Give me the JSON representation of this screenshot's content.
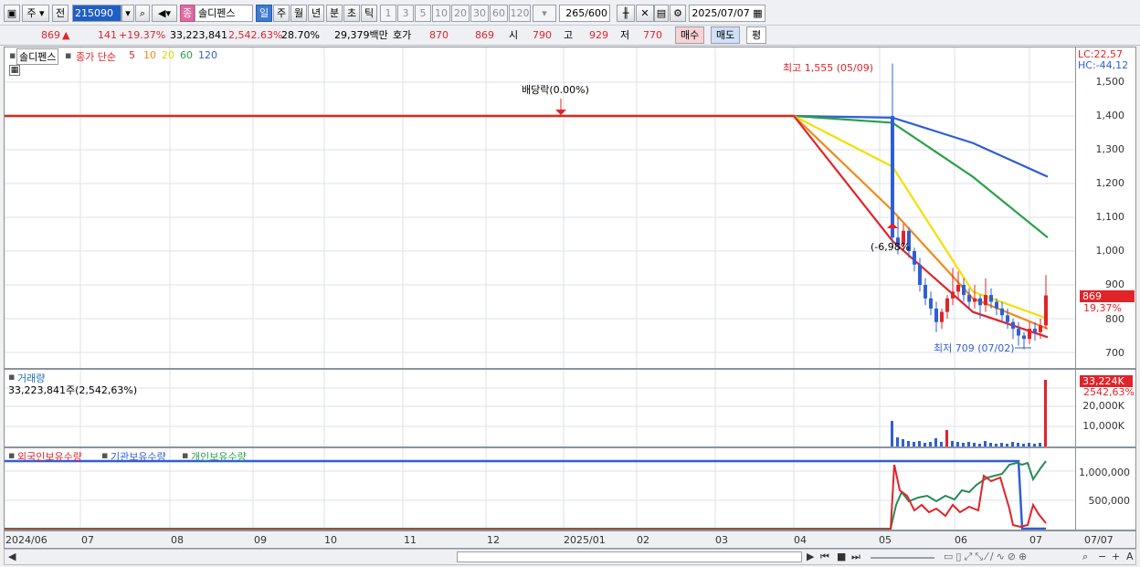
{
  "toolbar": {
    "period_sel": "주",
    "prev": "전",
    "code": "215090",
    "type_badge": "종",
    "stock_name": "솔디펜스",
    "periods": [
      "일",
      "주",
      "월",
      "년",
      "분",
      "초",
      "틱"
    ],
    "intervals": [
      "1",
      "3",
      "5",
      "10",
      "20",
      "30",
      "60",
      "120"
    ],
    "count": "265",
    "count_max": "/600",
    "date": "2025/07/07"
  },
  "quote": {
    "price": "869",
    "arrow": "▲",
    "change": "141",
    "change_pct": "+19.37%",
    "volume": "33,223,841",
    "volume_ratio": "2,542.63%",
    "turnover": "28.70%",
    "amount": "29,379백만",
    "bid_label": "호가",
    "bid1": "870",
    "bid2": "869",
    "open_label": "시",
    "open": "790",
    "high_label": "고",
    "high": "929",
    "low_label": "저",
    "low": "770",
    "buy": "매수",
    "sell": "매도",
    "flat": "평"
  },
  "price_panel": {
    "stock_chip": "솔디펜스",
    "ma_label": "종가 단순",
    "ma_periods": [
      "5",
      "10",
      "20",
      "60",
      "120"
    ],
    "ma_colors": [
      "#e0242a",
      "#f08a1c",
      "#f2e000",
      "#2aa04a",
      "#2f5fd6"
    ],
    "lc": "LC:22,57",
    "hc": "HC:-44,12",
    "y_ticks": [
      "1,500",
      "1,400",
      "1,300",
      "1,200",
      "1,100",
      "1,000",
      "900",
      "800",
      "700"
    ],
    "cur_price": "869",
    "cur_pct": "19,37%",
    "high_note": "최고 1,555 (05/09)",
    "low_note": "최저 709 (07/02)",
    "dividend_note": "배당락(0.00%)",
    "drop_note": "(-6,98%"
  },
  "volume_panel": {
    "title": "거래량",
    "summary": "33,223,841주(2,542,63%)",
    "cur": "33,224K",
    "cur_pct": "2542,63%",
    "y_ticks": [
      "20,000K",
      "10,000K"
    ]
  },
  "holding_panel": {
    "foreign": "외국인보유수량",
    "institution": "기관보유수량",
    "individual": "개인보유수량",
    "y_ticks": [
      "1,000,000",
      "500,000"
    ]
  },
  "x_labels": [
    "2024/06",
    "07",
    "08",
    "09",
    "10",
    "11",
    "12",
    "2025/01",
    "02",
    "03",
    "04",
    "05",
    "06",
    "07"
  ],
  "x_right": "07/07",
  "chart_data": {
    "type": "candlestick",
    "title": "",
    "ylim": [
      680,
      1580
    ],
    "x": [
      "2024/06",
      "07",
      "08",
      "09",
      "10",
      "11",
      "12",
      "2025/01",
      "02",
      "03",
      "04",
      "05",
      "06",
      "07"
    ],
    "series": [
      {
        "name": "5",
        "values": [
          1400,
          1400,
          1400,
          1400,
          1400,
          1400,
          1400,
          1400,
          1400,
          1400,
          1400,
          1030,
          820,
          745
        ]
      },
      {
        "name": "10",
        "values": [
          1400,
          1400,
          1400,
          1400,
          1400,
          1400,
          1400,
          1400,
          1400,
          1400,
          1400,
          1120,
          860,
          770
        ]
      },
      {
        "name": "20",
        "values": [
          1400,
          1400,
          1400,
          1400,
          1400,
          1400,
          1400,
          1400,
          1400,
          1400,
          1400,
          1250,
          880,
          800
        ]
      },
      {
        "name": "60",
        "values": [
          1400,
          1400,
          1400,
          1400,
          1400,
          1400,
          1400,
          1400,
          1400,
          1400,
          1400,
          1380,
          1220,
          1040
        ]
      },
      {
        "name": "120",
        "values": [
          1400,
          1400,
          1400,
          1400,
          1400,
          1400,
          1400,
          1400,
          1400,
          1400,
          1400,
          1395,
          1320,
          1220
        ]
      }
    ],
    "high": 1555,
    "low": 709,
    "close": 869
  }
}
